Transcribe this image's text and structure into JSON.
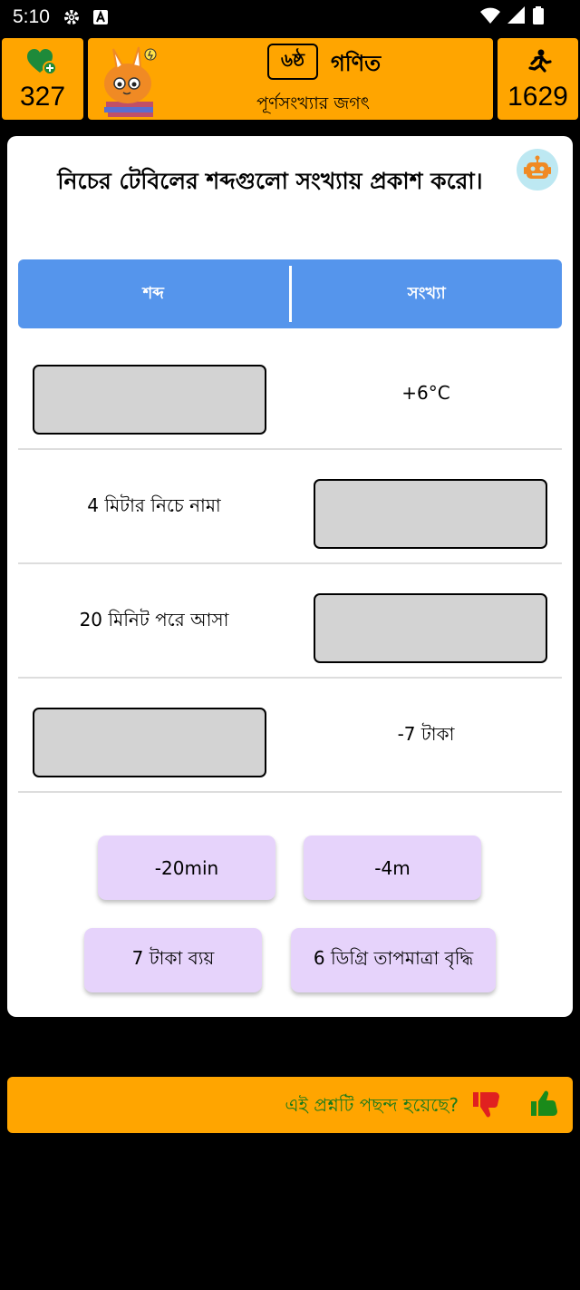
{
  "status_bar": {
    "time": "5:10"
  },
  "header": {
    "lives": "327",
    "grade": "৬ষ্ঠ",
    "subject": "গণিত",
    "chapter": "পূর্ণসংখ্যার জগৎ",
    "score": "1629"
  },
  "question": "নিচের টেবিলের শব্দগুলো সংখ্যায় প্রকাশ করো।",
  "table": {
    "headers": [
      "শব্দ",
      "সংখ্যা"
    ],
    "rows": [
      {
        "word": "",
        "number": "+6°C"
      },
      {
        "word": "4 মিটার নিচে নামা",
        "number": ""
      },
      {
        "word": "20 মিনিট পরে আসা",
        "number": ""
      },
      {
        "word": "",
        "number": "-7 টাকা"
      }
    ]
  },
  "options": [
    "-20min",
    "-4m",
    "7 টাকা ব্যয়",
    "6 ডিগ্রি তাপমাত্রা বৃদ্ধি"
  ],
  "feedback": {
    "question": "এই প্রশ্নটি পছন্দ হয়েছে?"
  },
  "colors": {
    "header_bg": "#FFA500",
    "table_header": "#5595EC",
    "slot_bg": "#D3D3D3",
    "chip_bg": "#E6D3FB",
    "feedback_text": "#1A7A1A",
    "thumb_down": "#E02020",
    "thumb_up": "#1A8A1A"
  },
  "icons": {
    "lives": "heart-plus-icon",
    "score": "runner-icon",
    "bot": "robot-icon",
    "dislike": "thumb-down-icon",
    "like": "thumb-up-icon"
  }
}
